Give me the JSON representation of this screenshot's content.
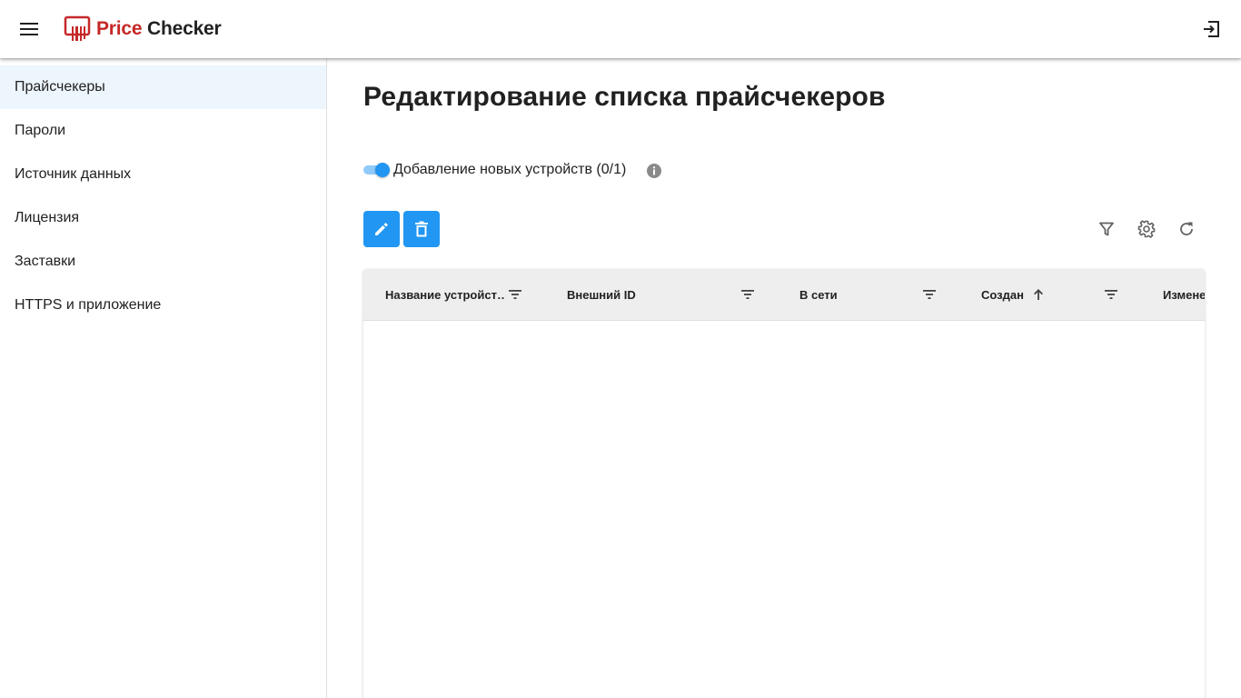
{
  "app": {
    "brand_part1": "Price",
    "brand_part2": "Checker",
    "brand_color": "#c62828"
  },
  "sidebar": {
    "items": [
      {
        "label": "Прайсчекеры",
        "active": true
      },
      {
        "label": "Пароли"
      },
      {
        "label": "Источник данных"
      },
      {
        "label": "Лицензия"
      },
      {
        "label": "Заставки"
      },
      {
        "label": "HTTPS и приложение"
      }
    ]
  },
  "main": {
    "title": "Редактирование списка прайсчекеров",
    "toggle": {
      "label": "Добавление новых устройств (0/1)",
      "checked": true
    },
    "accent_color": "#2196f3"
  },
  "table": {
    "columns": [
      {
        "label": "Название устройст…",
        "icon": "filter-lines-icon"
      },
      {
        "label": "Внешний ID",
        "icon": "filter-lines-icon"
      },
      {
        "label": "В сети",
        "icon": "filter-lines-icon"
      },
      {
        "label": "Создан",
        "sort": "arrow-up-icon",
        "icon": "filter-lines-icon"
      },
      {
        "label": "Изменен"
      }
    ],
    "rows": []
  }
}
